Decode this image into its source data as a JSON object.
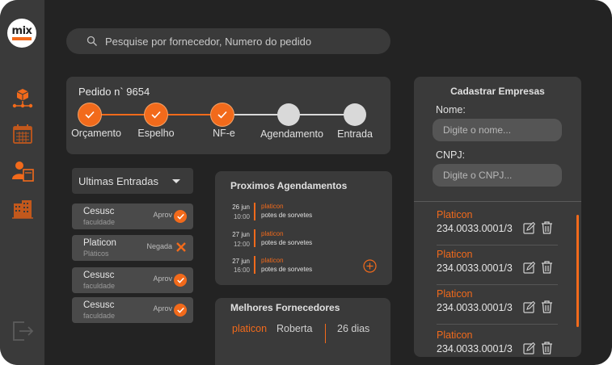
{
  "brand": {
    "logo_text": "mix",
    "accent": "#f26a1b"
  },
  "search": {
    "placeholder": "Pesquise por fornecedor, Numero do pedido"
  },
  "order": {
    "title": "Pedido n` 9654",
    "steps": [
      {
        "label": "Orçamento",
        "done": true
      },
      {
        "label": "Espelho",
        "done": true
      },
      {
        "label": "NF-e",
        "done": true
      },
      {
        "label": "Agendamento",
        "done": false
      },
      {
        "label": "Entrada",
        "done": false
      }
    ]
  },
  "entries": {
    "dropdown_label": "Ultimas Entradas",
    "items": [
      {
        "name": "Cesusc",
        "sub": "faculdade",
        "status": "Aprov",
        "icon": "check-icon"
      },
      {
        "name": "Platicon",
        "sub": "Pláticos",
        "status": "Negada",
        "icon": "x-icon"
      },
      {
        "name": "Cesusc",
        "sub": "faculdade",
        "status": "Aprov",
        "icon": "check-icon"
      },
      {
        "name": "Cesusc",
        "sub": "faculdade",
        "status": "Aprov",
        "icon": "check-icon"
      }
    ]
  },
  "schedule": {
    "title": "Proximos Agendamentos",
    "items": [
      {
        "date": "26 jun",
        "time": "10:00",
        "supplier": "platicon",
        "desc": "potes de sorvetes"
      },
      {
        "date": "27 jun",
        "time": "12:00",
        "supplier": "platicon",
        "desc": "potes de sorvetes"
      },
      {
        "date": "27 jun",
        "time": "16:00",
        "supplier": "platicon",
        "desc": "potes de sorvetes"
      }
    ]
  },
  "best_suppliers": {
    "title": "Melhores Fornecedores",
    "rows": [
      {
        "supplier": "platicon",
        "contact": "Roberta",
        "days": "26 dias"
      }
    ]
  },
  "register": {
    "title": "Cadastrar Empresas",
    "name_label": "Nome:",
    "name_placeholder": "Digite o nome...",
    "cnpj_label": "CNPJ:",
    "cnpj_placeholder": "Digite o CNPJ...",
    "companies": [
      {
        "name": "Platicon",
        "cnpj": "234.0033.0001/3"
      },
      {
        "name": "Platicon",
        "cnpj": "234.0033.0001/3"
      },
      {
        "name": "Platicon",
        "cnpj": "234.0033.0001/3"
      },
      {
        "name": "Platicon",
        "cnpj": "234.0033.0001/3"
      }
    ]
  }
}
